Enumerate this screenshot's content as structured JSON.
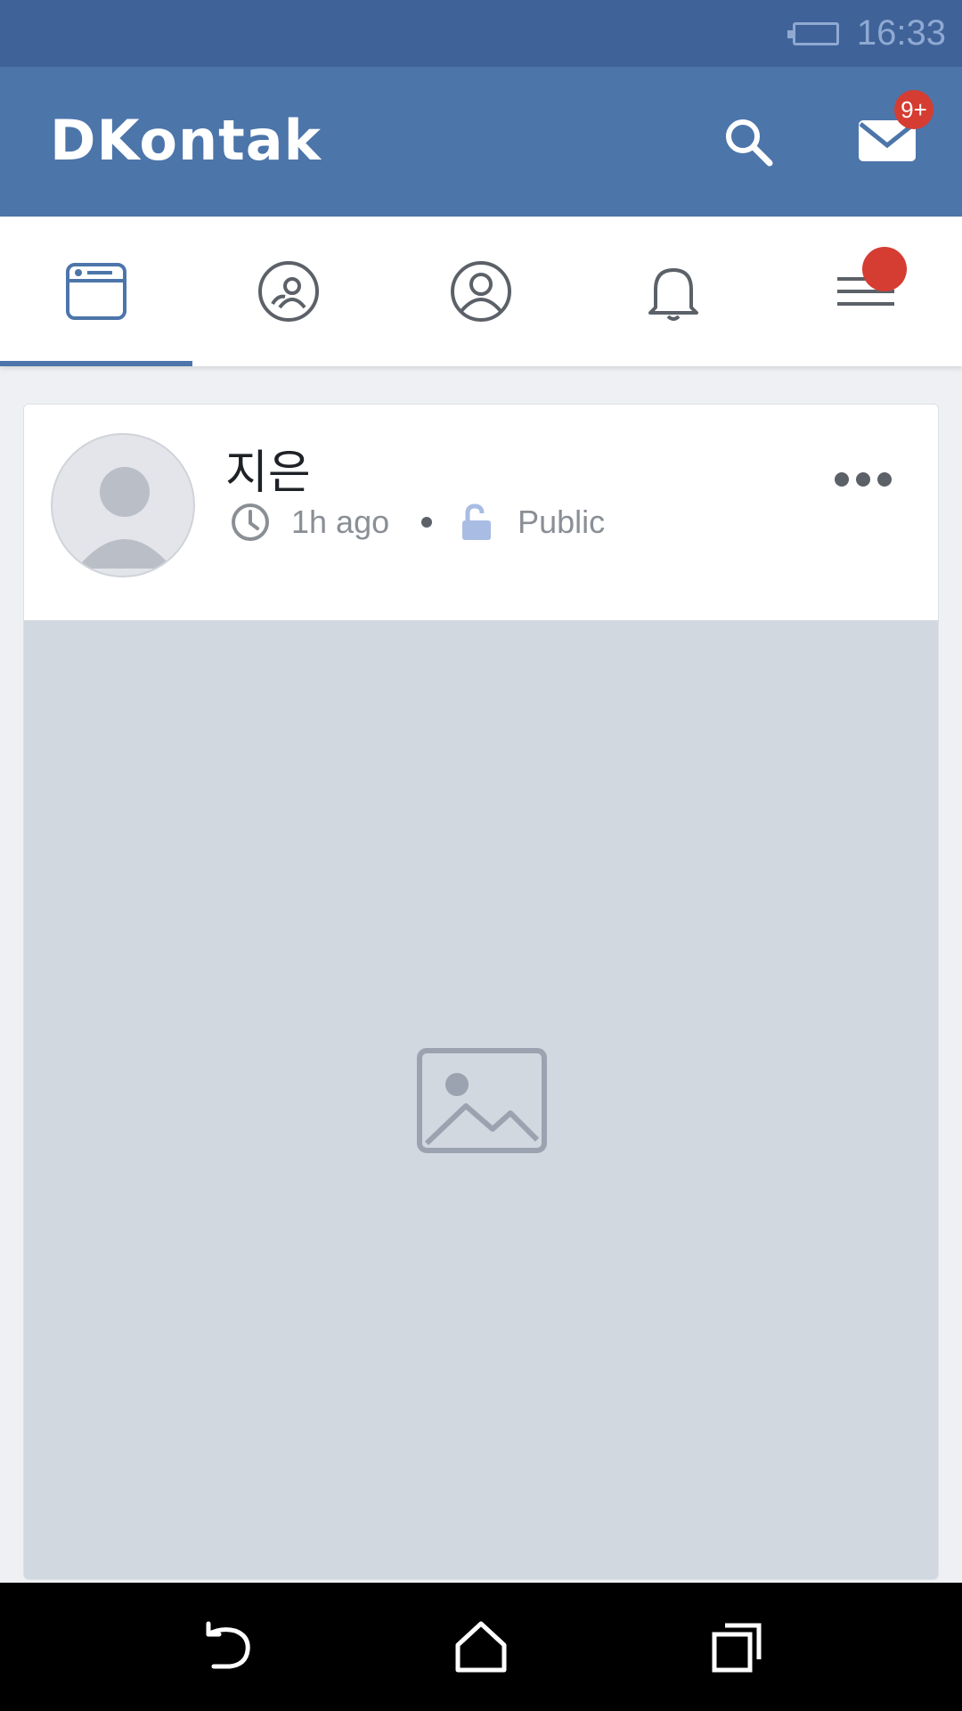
{
  "status_bar": {
    "time": "16:33"
  },
  "header": {
    "app_name": "DKontak",
    "mail_badge": "9+"
  },
  "tabs": [
    {
      "icon": "news-feed-icon",
      "active": true
    },
    {
      "icon": "friends-icon",
      "active": false
    },
    {
      "icon": "profile-icon",
      "active": false
    },
    {
      "icon": "bell-icon",
      "active": false
    },
    {
      "icon": "menu-icon",
      "active": false,
      "has_dot": true
    }
  ],
  "post": {
    "author": "지은",
    "time_ago": "1h ago",
    "privacy": "Public"
  },
  "nav_bar": {
    "icons": [
      "back-icon",
      "home-icon",
      "recents-icon"
    ]
  },
  "colors": {
    "header": "#4c75aa",
    "status_bar": "#3f6299",
    "badge": "#d53d32",
    "privacy_icon": "#a9bce3"
  }
}
